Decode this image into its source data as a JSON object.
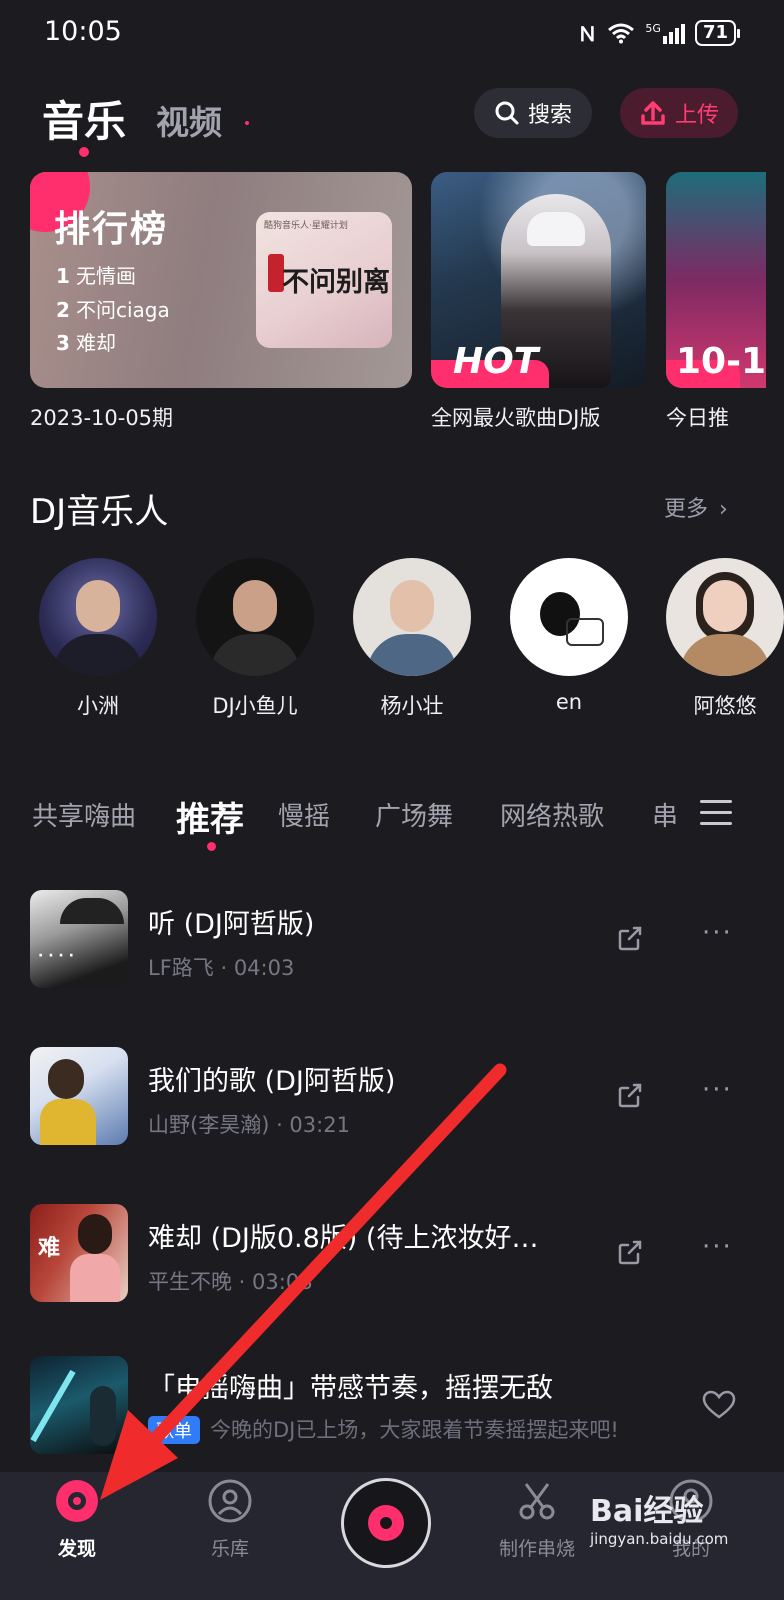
{
  "status_bar": {
    "time": "10:05",
    "battery": "71",
    "signal": "5G"
  },
  "header": {
    "tab_music": "音乐",
    "tab_video": "视频",
    "search_label": "搜索",
    "upload_label": "上传"
  },
  "cards": {
    "chart": {
      "title": "排行榜",
      "items": [
        {
          "rank": "1",
          "name": "无情画"
        },
        {
          "rank": "2",
          "name": "不问ciaga"
        },
        {
          "rank": "3",
          "name": "难却"
        }
      ],
      "cover_text": "不问别离",
      "cover_top": "酷狗音乐人·星耀计划",
      "caption": "2023-10-05期"
    },
    "hot": {
      "badge": "HOT",
      "caption": "全网最火歌曲DJ版"
    },
    "third": {
      "badge": "10-1",
      "caption": "今日推"
    }
  },
  "dj_section": {
    "title": "DJ音乐人",
    "more": "更多",
    "artists": [
      {
        "name": "小洲"
      },
      {
        "name": "DJ小鱼儿"
      },
      {
        "name": "杨小壮"
      },
      {
        "name": "en"
      },
      {
        "name": "阿悠悠"
      }
    ]
  },
  "categories": {
    "tabs": [
      "共享嗨曲",
      "推荐",
      "慢摇",
      "广场舞",
      "网络热歌",
      "串"
    ],
    "active": "推荐"
  },
  "songs": [
    {
      "title": "听 (DJ阿哲版)",
      "artist": "LF路飞",
      "duration": "04:03"
    },
    {
      "title": "我们的歌 (DJ阿哲版)",
      "artist": "山野(李昊瀚)",
      "duration": "03:21"
    },
    {
      "title": "难却 (DJ版0.8版) (待上浓妆好…",
      "artist": "平生不晚",
      "duration": "03:08"
    }
  ],
  "playlist": {
    "title": "「电摇嗨曲」带感节奏，摇摆无敌",
    "badge": "歌单",
    "desc": "今晚的DJ已上场，大家跟着节奏摇摆起来吧!"
  },
  "bottom_nav": {
    "discover": "发现",
    "library": "乐库",
    "mix": "制作串烧",
    "mine": "我的"
  },
  "watermark": {
    "brand": "Bai经验",
    "url": "jingyan.baidu.com"
  },
  "colors": {
    "accent": "#ff2e6d",
    "background": "#1b1b20",
    "nav_bg": "#262630",
    "badge_blue": "#2f7cf6"
  }
}
